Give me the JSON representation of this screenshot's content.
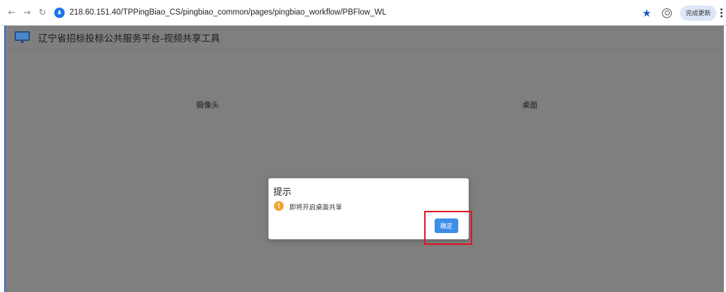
{
  "browser": {
    "url": "218.60.151.40/TPPingBiao_CS/pingbiao_common/pages/pingbiao_workflow/PBFlow_WL",
    "update_label": "完成更新"
  },
  "app": {
    "title": "辽宁省招标投标公共服务平台-视频共享工具",
    "camera_label": "摄像头",
    "desktop_label": "桌面"
  },
  "dialog": {
    "title": "提示",
    "icon_glyph": "!",
    "message": "即将开启桌面共享",
    "confirm_label": "确定"
  },
  "colors": {
    "overlay": "#7f7f7f",
    "confirm_button": "#3d8ee8",
    "warning_icon": "#f0a432",
    "highlight": "#e0141c"
  }
}
